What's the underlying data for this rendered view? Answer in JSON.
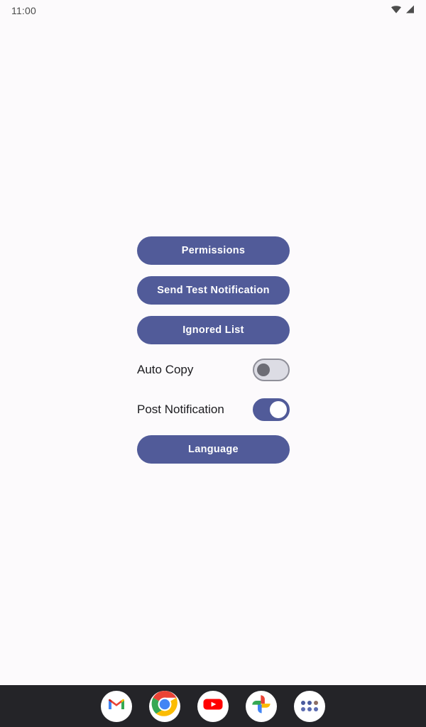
{
  "status_bar": {
    "clock": "11:00",
    "icons": [
      {
        "name": "wifi-icon",
        "label": "WiFi"
      },
      {
        "name": "cellular-signal-icon",
        "label": "Cellular signal"
      }
    ]
  },
  "theme": {
    "background": "#fcfafc",
    "accent": "#515b99",
    "button_text": "#ffffff",
    "label_text": "#1c1b1f",
    "switch_off_track": "#dcdce4",
    "switch_off_thumb": "#6d6d75",
    "dock_background": "#242428"
  },
  "main": {
    "buttons": [
      {
        "id": "permissions",
        "label": "Permissions"
      },
      {
        "id": "send-test-notification",
        "label": "Send Test Notification"
      },
      {
        "id": "ignored-list",
        "label": "Ignored List"
      }
    ],
    "switches": [
      {
        "id": "auto-copy",
        "label": "Auto Copy",
        "state": "off"
      },
      {
        "id": "post-notification",
        "label": "Post Notification",
        "state": "on"
      }
    ],
    "language_button": {
      "id": "language",
      "label": "Language"
    }
  },
  "dock": {
    "items": [
      {
        "name": "gmail-icon",
        "label": "Gmail"
      },
      {
        "name": "chrome-icon",
        "label": "Chrome"
      },
      {
        "name": "youtube-icon",
        "label": "YouTube"
      },
      {
        "name": "google-photos-icon",
        "label": "Photos"
      },
      {
        "name": "app-drawer-icon",
        "label": "All apps"
      }
    ]
  }
}
